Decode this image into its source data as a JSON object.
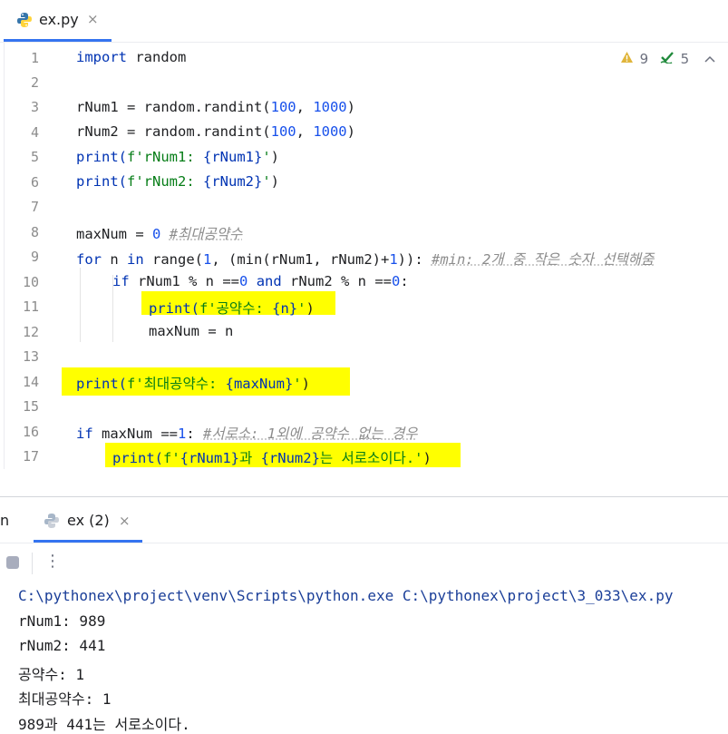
{
  "editor_tab": {
    "label": "ex.py",
    "close": "×"
  },
  "inspections": {
    "warnings": "9",
    "ok": "5"
  },
  "lines": [
    {
      "n": "1"
    },
    {
      "n": "2"
    },
    {
      "n": "3"
    },
    {
      "n": "4"
    },
    {
      "n": "5"
    },
    {
      "n": "6"
    },
    {
      "n": "7"
    },
    {
      "n": "8"
    },
    {
      "n": "9"
    },
    {
      "n": "10"
    },
    {
      "n": "11"
    },
    {
      "n": "12"
    },
    {
      "n": "13"
    },
    {
      "n": "14"
    },
    {
      "n": "15"
    },
    {
      "n": "16"
    },
    {
      "n": "17"
    }
  ],
  "code": {
    "l1_kw": "import",
    "l1_rest": " random",
    "l3_a": "rNum1 = random.randint(",
    "l3_n1": "100",
    "l3_b": ", ",
    "l3_n2": "1000",
    "l3_c": ")",
    "l4_a": "rNum2 = random.randint(",
    "l4_n1": "100",
    "l4_b": ", ",
    "l4_n2": "1000",
    "l4_c": ")",
    "l5_a": "print(",
    "l5_s": "f'rNum1: ",
    "l5_v": "{rNum1}",
    "l5_s2": "'",
    "l5_c": ")",
    "l6_a": "print(",
    "l6_s": "f'rNum2: ",
    "l6_v": "{rNum2}",
    "l6_s2": "'",
    "l6_c": ")",
    "l8_a": "maxNum = ",
    "l8_n": "0",
    "l8_sp": " ",
    "l8_cmt": "#최대공약수",
    "l9_kw1": "for",
    "l9_a": " n ",
    "l9_kw2": "in",
    "l9_b": " range(",
    "l9_n1": "1",
    "l9_c": ", (min(rNum1, rNum2)+",
    "l9_n2": "1",
    "l9_d": ")): ",
    "l9_cmt": "#min: 2개 중 작은 숫자 선택해줌",
    "l10_kw1": "if",
    "l10_a": " rNum1 % n ==",
    "l10_n1": "0",
    "l10_sp": " ",
    "l10_kw2": "and",
    "l10_b": " rNum2 % n ==",
    "l10_n2": "0",
    "l10_c": ":",
    "l11_a": "print(",
    "l11_s": "f'공약수: ",
    "l11_v": "{n}",
    "l11_s2": "'",
    "l11_c": ")",
    "l12": "maxNum = n",
    "l14_a": "print(",
    "l14_s": "f'최대공약수: ",
    "l14_v": "{maxNum}",
    "l14_s2": "'",
    "l14_c": ")",
    "l16_kw": "if",
    "l16_a": " maxNum ==",
    "l16_n": "1",
    "l16_b": ": ",
    "l16_cmt": "#서로소: 1외에 공약수 없는 경우",
    "l17_a": "print(",
    "l17_s": "f'",
    "l17_v1": "{rNum1}",
    "l17_s2": "과 ",
    "l17_v2": "{rNum2}",
    "l17_s3": "는 서로소이다.'",
    "l17_c": ")"
  },
  "run_panel": {
    "left_label": "n",
    "tab_label": "ex (2)",
    "close": "×",
    "menu": "⋮"
  },
  "console": [
    "C:\\pythonex\\project\\venv\\Scripts\\python.exe C:\\pythonex\\project\\3_033\\ex.py",
    "rNum1: 989",
    "rNum2: 441",
    "공약수: 1",
    "최대공약수: 1",
    "989과 441는 서로소이다."
  ],
  "colors": {
    "accent": "#3574f0",
    "highlight": "#ffff00",
    "keyword": "#0033b3",
    "string": "#067d17",
    "number": "#1750eb"
  }
}
